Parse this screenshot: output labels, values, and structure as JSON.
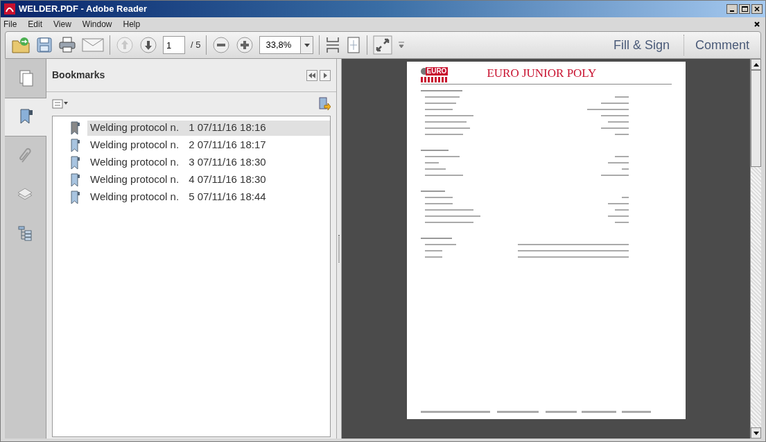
{
  "window": {
    "title": "WELDER.PDF - Adobe Reader"
  },
  "menu": [
    "File",
    "Edit",
    "View",
    "Window",
    "Help"
  ],
  "toolbar": {
    "page_number": "1",
    "page_count": "/ 5",
    "zoom": "33,8%",
    "fill_sign": "Fill & Sign",
    "comment": "Comment"
  },
  "side_tabs": [
    {
      "kind": "pages",
      "selected": false
    },
    {
      "kind": "bookmarks",
      "selected": true
    },
    {
      "kind": "attachments",
      "selected": false
    },
    {
      "kind": "layers",
      "selected": false
    },
    {
      "kind": "tree",
      "selected": false
    }
  ],
  "bookmarks": {
    "title": "Bookmarks",
    "items": [
      {
        "label": "Welding protocol n.",
        "detail": "1 07/11/16 18:16",
        "selected": true
      },
      {
        "label": "Welding protocol n.",
        "detail": "2 07/11/16 18:17",
        "selected": false
      },
      {
        "label": "Welding protocol n.",
        "detail": "3 07/11/16 18:30",
        "selected": false
      },
      {
        "label": "Welding protocol n.",
        "detail": "4 07/11/16 18:30",
        "selected": false
      },
      {
        "label": "Welding protocol n.",
        "detail": "5 07/11/16 18:44",
        "selected": false
      }
    ]
  },
  "document": {
    "logo": "EURO",
    "heading": "EURO JUNIOR POLY"
  }
}
